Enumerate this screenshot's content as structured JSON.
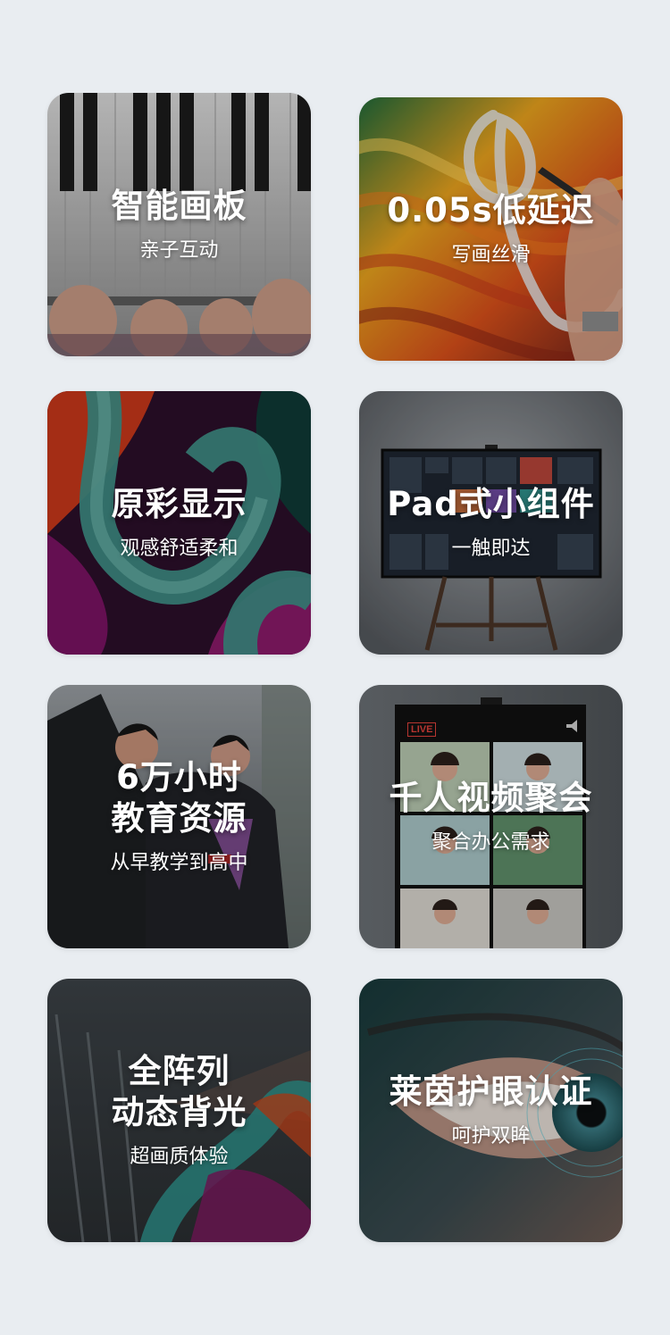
{
  "page": {
    "background": "#e9edf1"
  },
  "cards": [
    {
      "title": "智能画板",
      "subtitle": "亲子互动",
      "image": "piano-hands-image"
    },
    {
      "title": "0.05s低延迟",
      "subtitle": "写画丝滑",
      "image": "stylus-drawing-image"
    },
    {
      "title": "原彩显示",
      "subtitle": "观感舒适柔和",
      "image": "color-waves-image"
    },
    {
      "title": "Pad式小组件",
      "subtitle": "一触即达",
      "image": "tv-widgets-image"
    },
    {
      "title": "6万小时\n教育资源",
      "subtitle": "从早教学到高中",
      "image": "graduates-image"
    },
    {
      "title": "千人视频聚会",
      "subtitle": "聚合办公需求",
      "image": "video-call-grid-image",
      "badge": "LIVE"
    },
    {
      "title": "全阵列\n动态背光",
      "subtitle": "超画质体验",
      "image": "backlight-waves-image"
    },
    {
      "title": "莱茵护眼认证",
      "subtitle": "呵护双眸",
      "image": "eye-closeup-image"
    }
  ]
}
